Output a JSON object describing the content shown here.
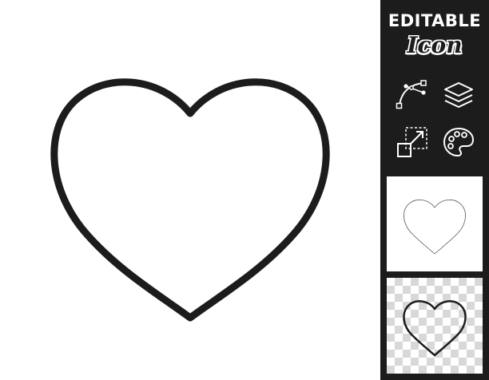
{
  "badge": {
    "title": "EDITABLE",
    "subtitle": "Icon"
  },
  "icons": {
    "main": "heart-outline-icon",
    "tools": [
      "bezier-curve-icon",
      "layers-icon",
      "resize-icon",
      "palette-icon"
    ],
    "preview_white": "heart-thin-outline-icon",
    "preview_transparent": "heart-outline-icon"
  },
  "colors": {
    "stroke": "#1c1c1c",
    "sidebar_background": "#1c1c1c",
    "badge_text": "#ffffff",
    "checker": "#d8d8d8"
  }
}
